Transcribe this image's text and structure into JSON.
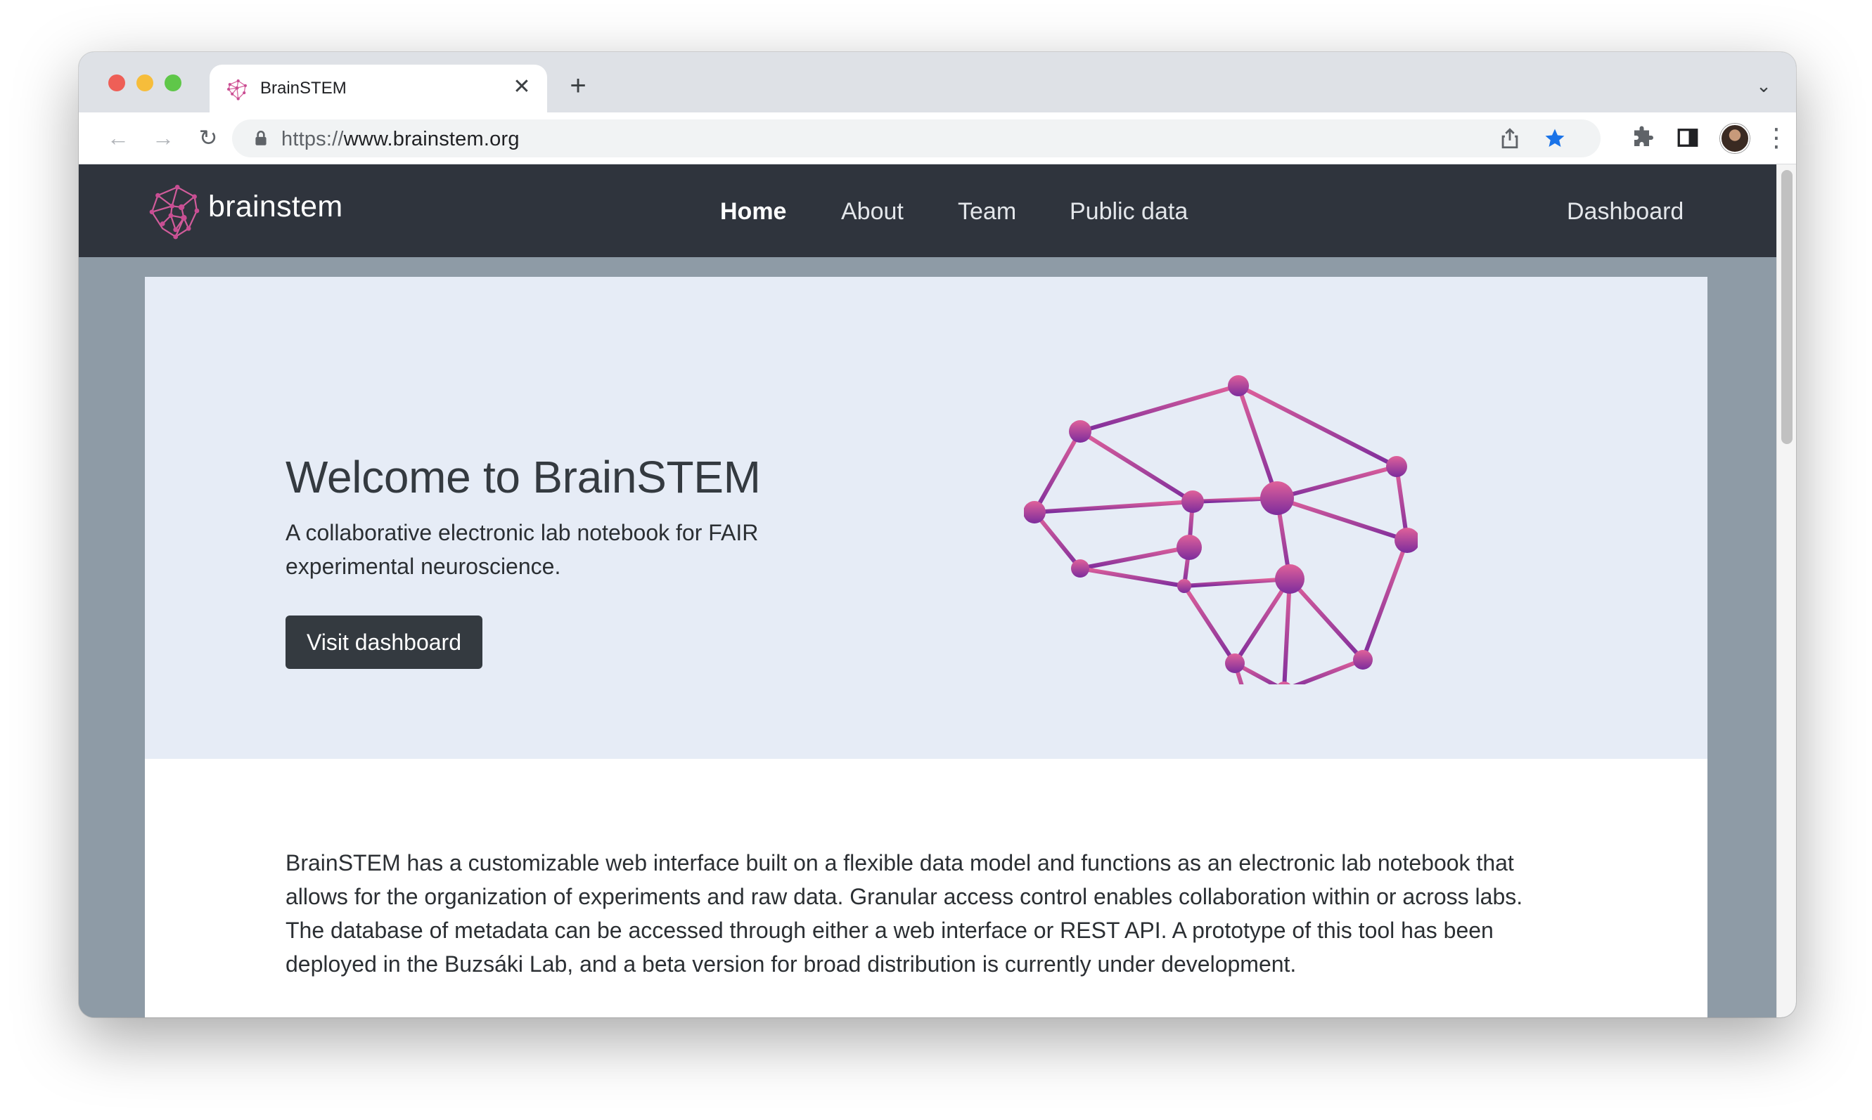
{
  "browser": {
    "tab_title": "BrainSTEM",
    "tab_close": "✕",
    "new_tab": "+",
    "tab_search": "⌄",
    "back": "←",
    "forward": "→",
    "reload": "↻",
    "url_scheme": "https://",
    "url_host": "www.brainstem.org",
    "menu": "⋮",
    "bookmark_color": "#1a73e8"
  },
  "site": {
    "brand": "brainstem",
    "brand_color": "#d65f9e",
    "nav": {
      "home": "Home",
      "about": "About",
      "team": "Team",
      "public_data": "Public data",
      "dashboard": "Dashboard",
      "active": "Home"
    }
  },
  "hero": {
    "title": "Welcome to BrainSTEM",
    "subtitle": "A collaborative electronic lab notebook for FAIR experimental neuroscience.",
    "button": "Visit dashboard"
  },
  "content": {
    "intro": "BrainSTEM has a customizable web interface built on a flexible data model and functions as an electronic lab notebook that allows for the organization of experiments and raw data. Granular access control enables collaboration within or across labs. The database of metadata can be accessed through either a web interface or REST API. A prototype of this tool has been deployed in the Buzsáki Lab, and a beta version for broad distribution is currently under development."
  },
  "icons": {
    "favicon": "brain-network-icon",
    "lock": "lock-icon",
    "share": "share-icon",
    "bookmark": "star-icon",
    "extensions": "puzzle-icon",
    "side_panel": "side-panel-icon",
    "logo": "brain-network-icon"
  }
}
